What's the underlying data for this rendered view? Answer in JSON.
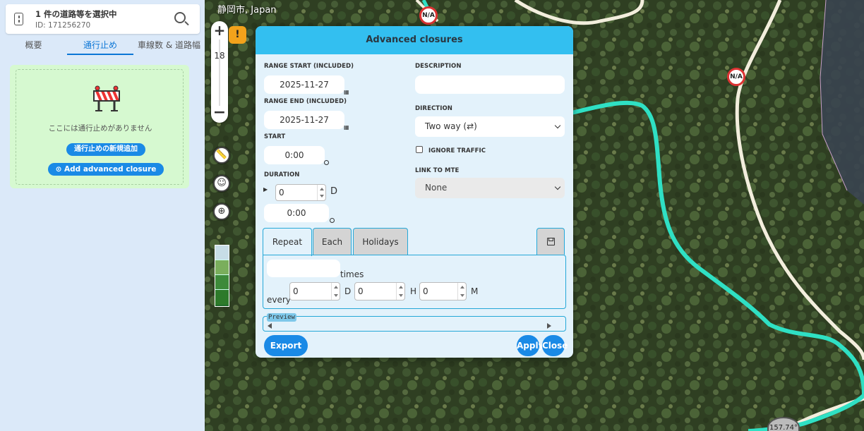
{
  "segment": {
    "title": "1 件の道路等を選択中",
    "id_text": "ID: 171256270"
  },
  "tabs": [
    {
      "label": "概要"
    },
    {
      "label": "通行止め"
    },
    {
      "label": "車線数 & 道路幅"
    }
  ],
  "closures_panel": {
    "empty_text": "ここには通行止めがありません",
    "new_closure_label": "通行止めの新規追加",
    "advanced_closure_label": "⊙ Add advanced closure"
  },
  "map": {
    "location_label": "静岡市, Japan",
    "zoom_level": "18",
    "na_label_1": "N/A",
    "na_label_2": "N/A",
    "angle_label": "157.74°",
    "warning_glyph": "!"
  },
  "modal": {
    "title": "Advanced closures",
    "range_start_label": "RANGE START (INCLUDED)",
    "range_start_value": "2025-11-27",
    "range_end_label": "RANGE END (INCLUDED)",
    "range_end_value": "2025-11-27",
    "start_label": "START",
    "start_value": "0:00",
    "duration_label": "DURATION",
    "duration_days_value": "0",
    "duration_days_unit": "D",
    "duration_time_value": "0:00",
    "description_label": "DESCRIPTION",
    "description_value": "",
    "direction_label": "DIRECTION",
    "direction_value": "Two way (⇄)",
    "ignore_traffic_label": "IGNORE TRAFFIC",
    "ignore_traffic_checked": false,
    "link_mte_label": "LINK TO MTE",
    "link_mte_value": "None",
    "repeat_tabs": [
      {
        "label": "Repeat"
      },
      {
        "label": "Each"
      },
      {
        "label": "Holidays"
      }
    ],
    "times_value": "",
    "times_label": "times",
    "every_label": "every",
    "every_days": "0",
    "every_days_unit": "D",
    "every_hours": "0",
    "every_hours_unit": "H",
    "every_minutes": "0",
    "every_minutes_unit": "M",
    "preview_label": "Preview",
    "export_label": "Export CSV",
    "apply_label": "Apply",
    "close_label": "Close"
  },
  "colors": {
    "accent": "#1a8ae6",
    "header": "#33bff0",
    "road_highlight": "#2fe0c4",
    "closure_panel_bg": "#d6f9d0",
    "warning": "#f3a21b"
  }
}
